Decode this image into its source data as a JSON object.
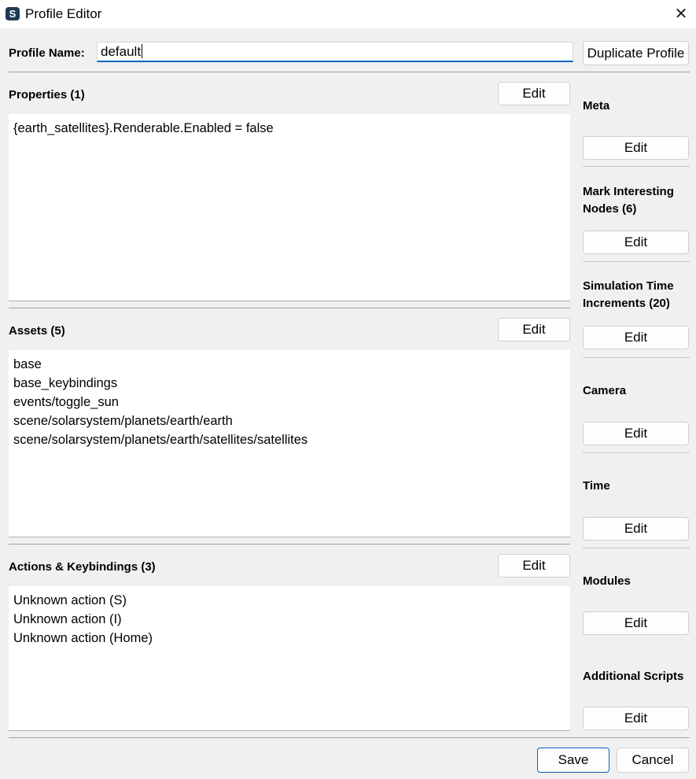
{
  "window": {
    "title": "Profile Editor",
    "icon": "openspace-logo-icon",
    "close_glyph": "✕"
  },
  "profile": {
    "name_label": "Profile Name:",
    "name_value": "default",
    "duplicate_label": "Duplicate Profile"
  },
  "sections": {
    "properties": {
      "title": "Properties (1)",
      "edit_label": "Edit",
      "items": [
        "{earth_satellites}.Renderable.Enabled = false"
      ]
    },
    "assets": {
      "title": "Assets (5)",
      "edit_label": "Edit",
      "items": [
        "base",
        "base_keybindings",
        "events/toggle_sun",
        "scene/solarsystem/planets/earth/earth",
        "scene/solarsystem/planets/earth/satellites/satellites"
      ]
    },
    "actions": {
      "title": "Actions & Keybindings (3)",
      "edit_label": "Edit",
      "items": [
        "Unknown action (S)",
        "Unknown action (I)",
        "Unknown action (Home)"
      ]
    }
  },
  "sidebar": {
    "items": [
      {
        "title": "Meta",
        "edit_label": "Edit"
      },
      {
        "title": "Mark Interesting Nodes (6)",
        "edit_label": "Edit"
      },
      {
        "title": "Simulation Time Increments (20)",
        "edit_label": "Edit"
      },
      {
        "title": "Camera",
        "edit_label": "Edit"
      },
      {
        "title": "Time",
        "edit_label": "Edit"
      },
      {
        "title": "Modules",
        "edit_label": "Edit"
      },
      {
        "title": "Additional Scripts",
        "edit_label": "Edit"
      }
    ]
  },
  "footer": {
    "save_label": "Save",
    "cancel_label": "Cancel"
  }
}
